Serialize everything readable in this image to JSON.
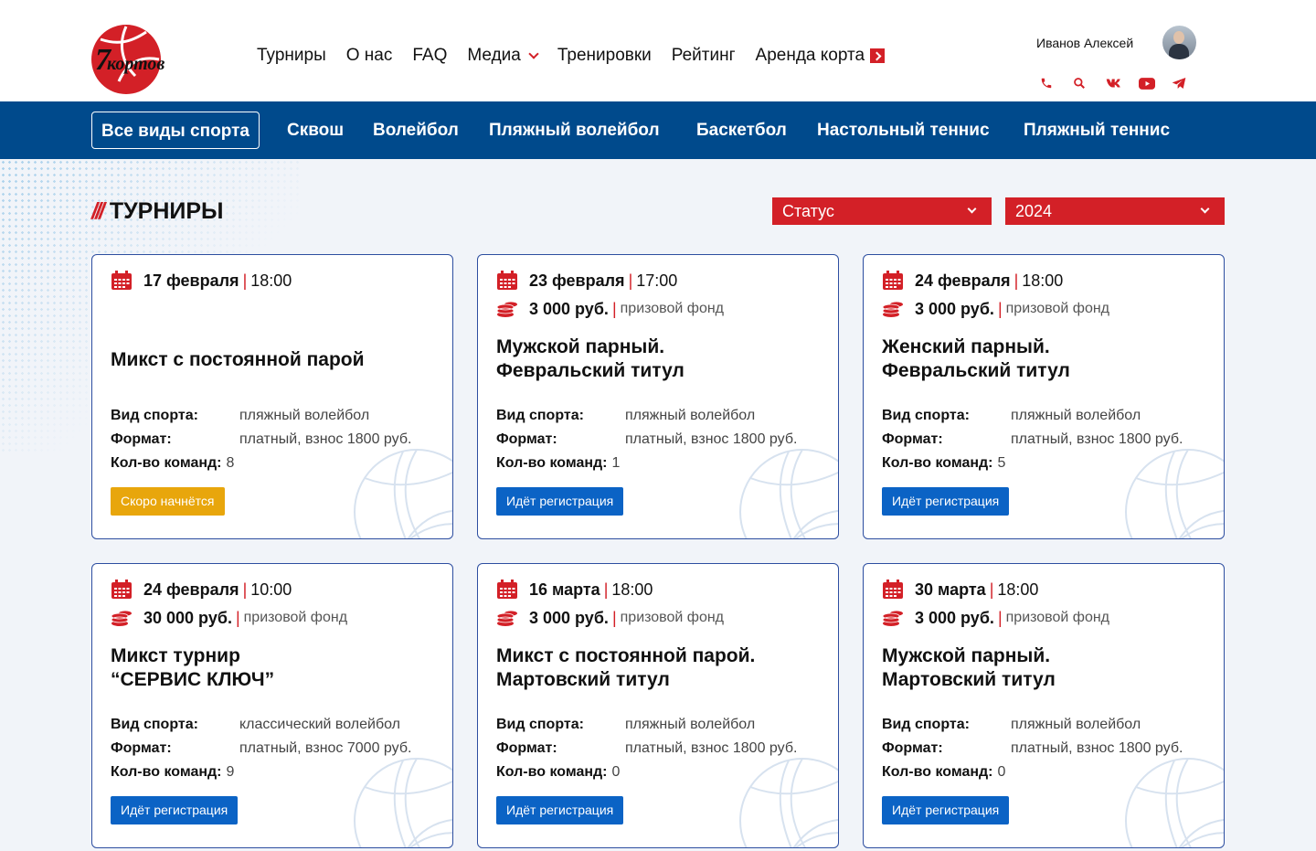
{
  "logo": {
    "number": "7",
    "word": "кортов"
  },
  "nav": [
    {
      "label": "Турниры"
    },
    {
      "label": "О нас"
    },
    {
      "label": "FAQ"
    },
    {
      "label": "Медиа"
    },
    {
      "label": "Тренировки"
    },
    {
      "label": "Рейтинг"
    },
    {
      "label": "Аренда корта"
    }
  ],
  "user": {
    "name": "Иванов Алексей"
  },
  "socials": [
    "phone-icon",
    "search-icon",
    "vk-icon",
    "youtube-icon",
    "telegram-icon"
  ],
  "sports": [
    {
      "label": "Все виды спорта"
    },
    {
      "label": "Сквош"
    },
    {
      "label": "Волейбол"
    },
    {
      "label": "Пляжный волейбол"
    },
    {
      "label": "Баскетбол"
    },
    {
      "label": "Настольный теннис"
    },
    {
      "label": "Пляжный теннис"
    }
  ],
  "section": {
    "slashes": "///",
    "title": "ТУРНИРЫ"
  },
  "filters": {
    "status": "Статус",
    "year": "2024"
  },
  "labels": {
    "sport": "Вид спорта:",
    "format": "Формат:",
    "teams": "Кол-во команд:",
    "prize_suffix": "призовой фонд"
  },
  "cards": [
    {
      "date": "17 февраля",
      "time": "18:00",
      "prize": "",
      "title1": "Микст с постоянной парой",
      "title2": "",
      "sport": "пляжный волейбол",
      "format": "платный, взнос 1800 руб.",
      "teams": "8",
      "button": "Скоро начнётся",
      "status": "soon"
    },
    {
      "date": "23 февраля",
      "time": "17:00",
      "prize": "3 000 руб.",
      "title1": "Мужской парный.",
      "title2": "Февральский титул",
      "sport": "пляжный волейбол",
      "format": "платный, взнос 1800 руб.",
      "teams": "1",
      "button": "Идёт регистрация",
      "status": "reg"
    },
    {
      "date": "24 февраля",
      "time": "18:00",
      "prize": "3 000 руб.",
      "title1": "Женский парный.",
      "title2": "Февральский титул",
      "sport": "пляжный волейбол",
      "format": "платный, взнос 1800 руб.",
      "teams": "5",
      "button": "Идёт регистрация",
      "status": "reg"
    },
    {
      "date": "24 февраля",
      "time": "10:00",
      "prize": "30 000 руб.",
      "title1": "Микст турнир",
      "title2": "“СЕРВИС КЛЮЧ”",
      "sport": "классический волейбол",
      "format": "платный, взнос 7000 руб.",
      "teams": "9",
      "button": "Идёт регистрация",
      "status": "reg"
    },
    {
      "date": "16 марта",
      "time": "18:00",
      "prize": "3 000 руб.",
      "title1": "Микст с постоянной парой.",
      "title2": "Мартовский титул",
      "sport": "пляжный волейбол",
      "format": "платный, взнос 1800 руб.",
      "teams": "0",
      "button": "Идёт регистрация",
      "status": "reg"
    },
    {
      "date": "30 марта",
      "time": "18:00",
      "prize": "3 000 руб.",
      "title1": "Мужской парный.",
      "title2": "Мартовский титул",
      "sport": "пляжный волейбол",
      "format": "платный, взнос 1800 руб.",
      "teams": "0",
      "button": "Идёт регистрация",
      "status": "reg"
    }
  ],
  "colors": {
    "accent": "#d32027",
    "navy": "#004a8c",
    "button": "#0b63c5",
    "warning": "#e8a60c",
    "card_border": "#2d4ea0"
  }
}
